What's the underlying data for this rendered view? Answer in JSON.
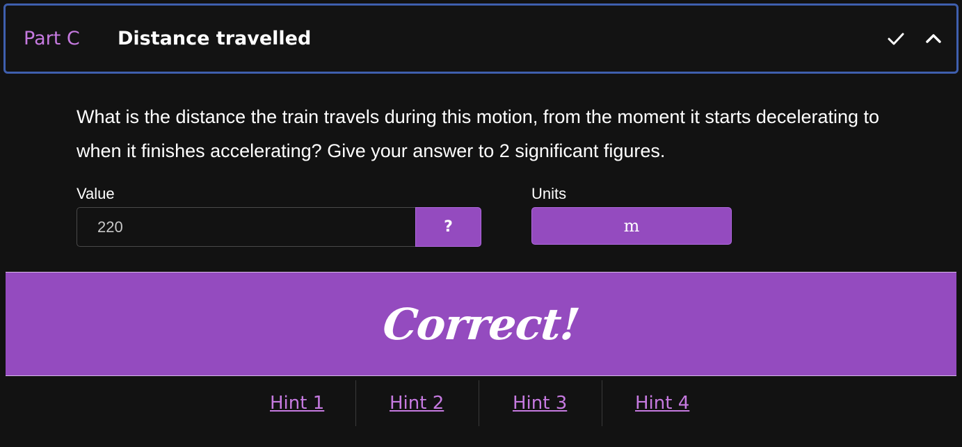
{
  "header": {
    "part_label": "Part C",
    "title": "Distance travelled",
    "check_icon": "check-icon",
    "collapse_icon": "chevron-up-icon"
  },
  "question": {
    "text": "What is the distance the train travels during this motion, from the moment it starts decelerating to when it finishes accelerating? Give your answer to 2 significant figures."
  },
  "value_field": {
    "label": "Value",
    "value": "220",
    "help_label": "?"
  },
  "units_field": {
    "label": "Units",
    "selected": "m"
  },
  "feedback": {
    "text": "Correct!"
  },
  "hints": [
    {
      "label": "Hint 1"
    },
    {
      "label": "Hint 2"
    },
    {
      "label": "Hint 3"
    },
    {
      "label": "Hint 4"
    }
  ],
  "colors": {
    "accent": "#944bbf",
    "link": "#c67ae0",
    "header_border": "#3f5fae",
    "background": "#121212"
  }
}
